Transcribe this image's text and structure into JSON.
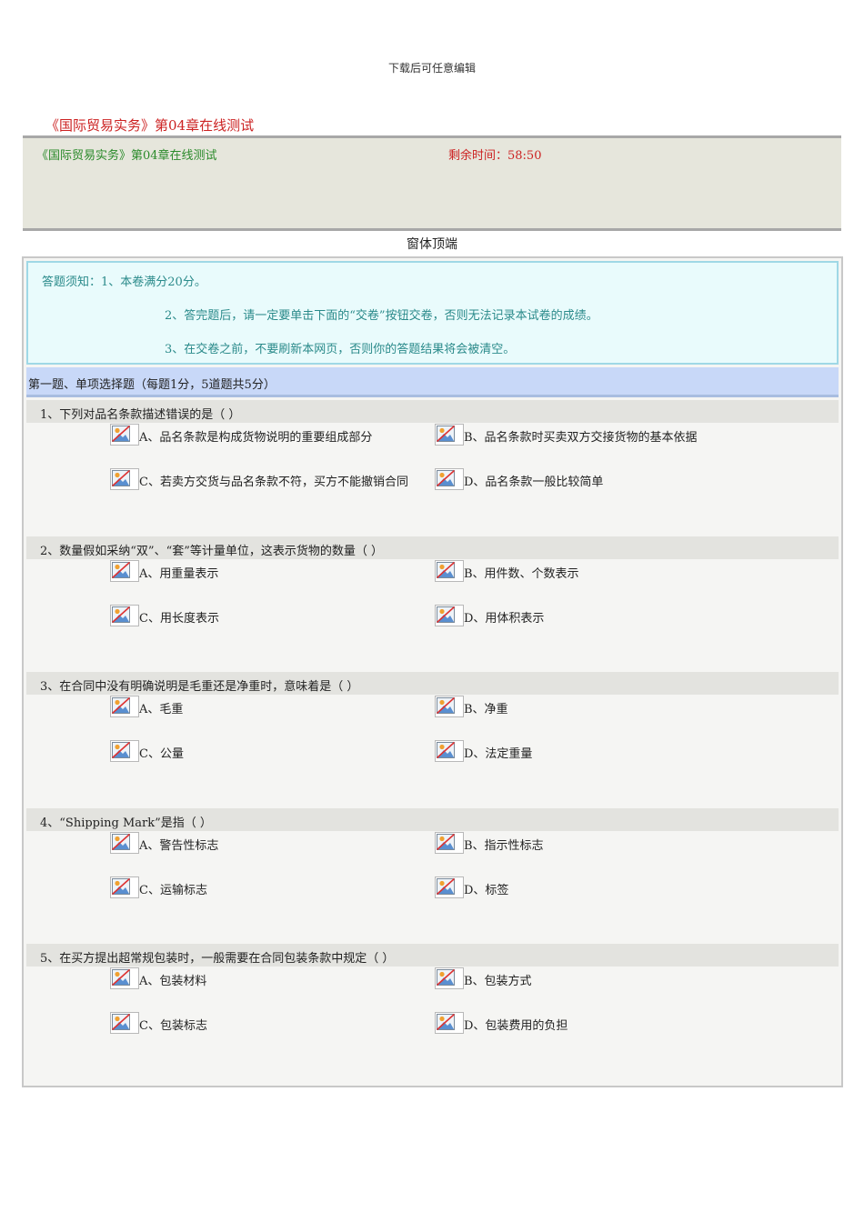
{
  "header_note": "下载后可任意编辑",
  "doc_title": "《国际贸易实务》第04章在线测试",
  "status": {
    "title": "《国际贸易实务》第04章在线测试",
    "timer": "剩余时间：58:50"
  },
  "form_top": "窗体顶端",
  "instructions": [
    "答题须知：1、本卷满分20分。",
    "2、答完题后，请一定要单击下面的“交卷”按钮交卷，否则无法记录本试卷的成绩。",
    "3、在交卷之前，不要刷新本网页，否则你的答题结果将会被清空。"
  ],
  "section": "第一题、单项选择题（每题1分，5道题共5分）",
  "questions": [
    {
      "text": "1、下列对品名条款描述错误的是（ ）",
      "options": [
        "A、品名条款是构成货物说明的重要组成部分",
        "B、品名条款时买卖双方交接货物的基本依据",
        "C、若卖方交货与品名条款不符，买方不能撤销合同",
        "D、品名条款一般比较简单"
      ]
    },
    {
      "text": "2、数量假如采纳“双”、“套”等计量单位，这表示货物的数量（ ）",
      "options": [
        "A、用重量表示",
        "B、用件数、个数表示",
        "C、用长度表示",
        "D、用体积表示"
      ]
    },
    {
      "text": "3、在合同中没有明确说明是毛重还是净重时，意味着是（ ）",
      "options": [
        "A、毛重",
        "B、净重",
        "C、公量",
        "D、法定重量"
      ]
    },
    {
      "text": "4、“Shipping Mark”是指（ ）",
      "options": [
        "A、警告性标志",
        "B、指示性标志",
        "C、运输标志",
        "D、标签"
      ]
    },
    {
      "text": "5、在买方提出超常规包装时，一般需要在合同包装条款中规定（ ）",
      "options": [
        "A、包装材料",
        "B、包装方式",
        "C、包装标志",
        "D、包装费用的负担"
      ]
    }
  ]
}
